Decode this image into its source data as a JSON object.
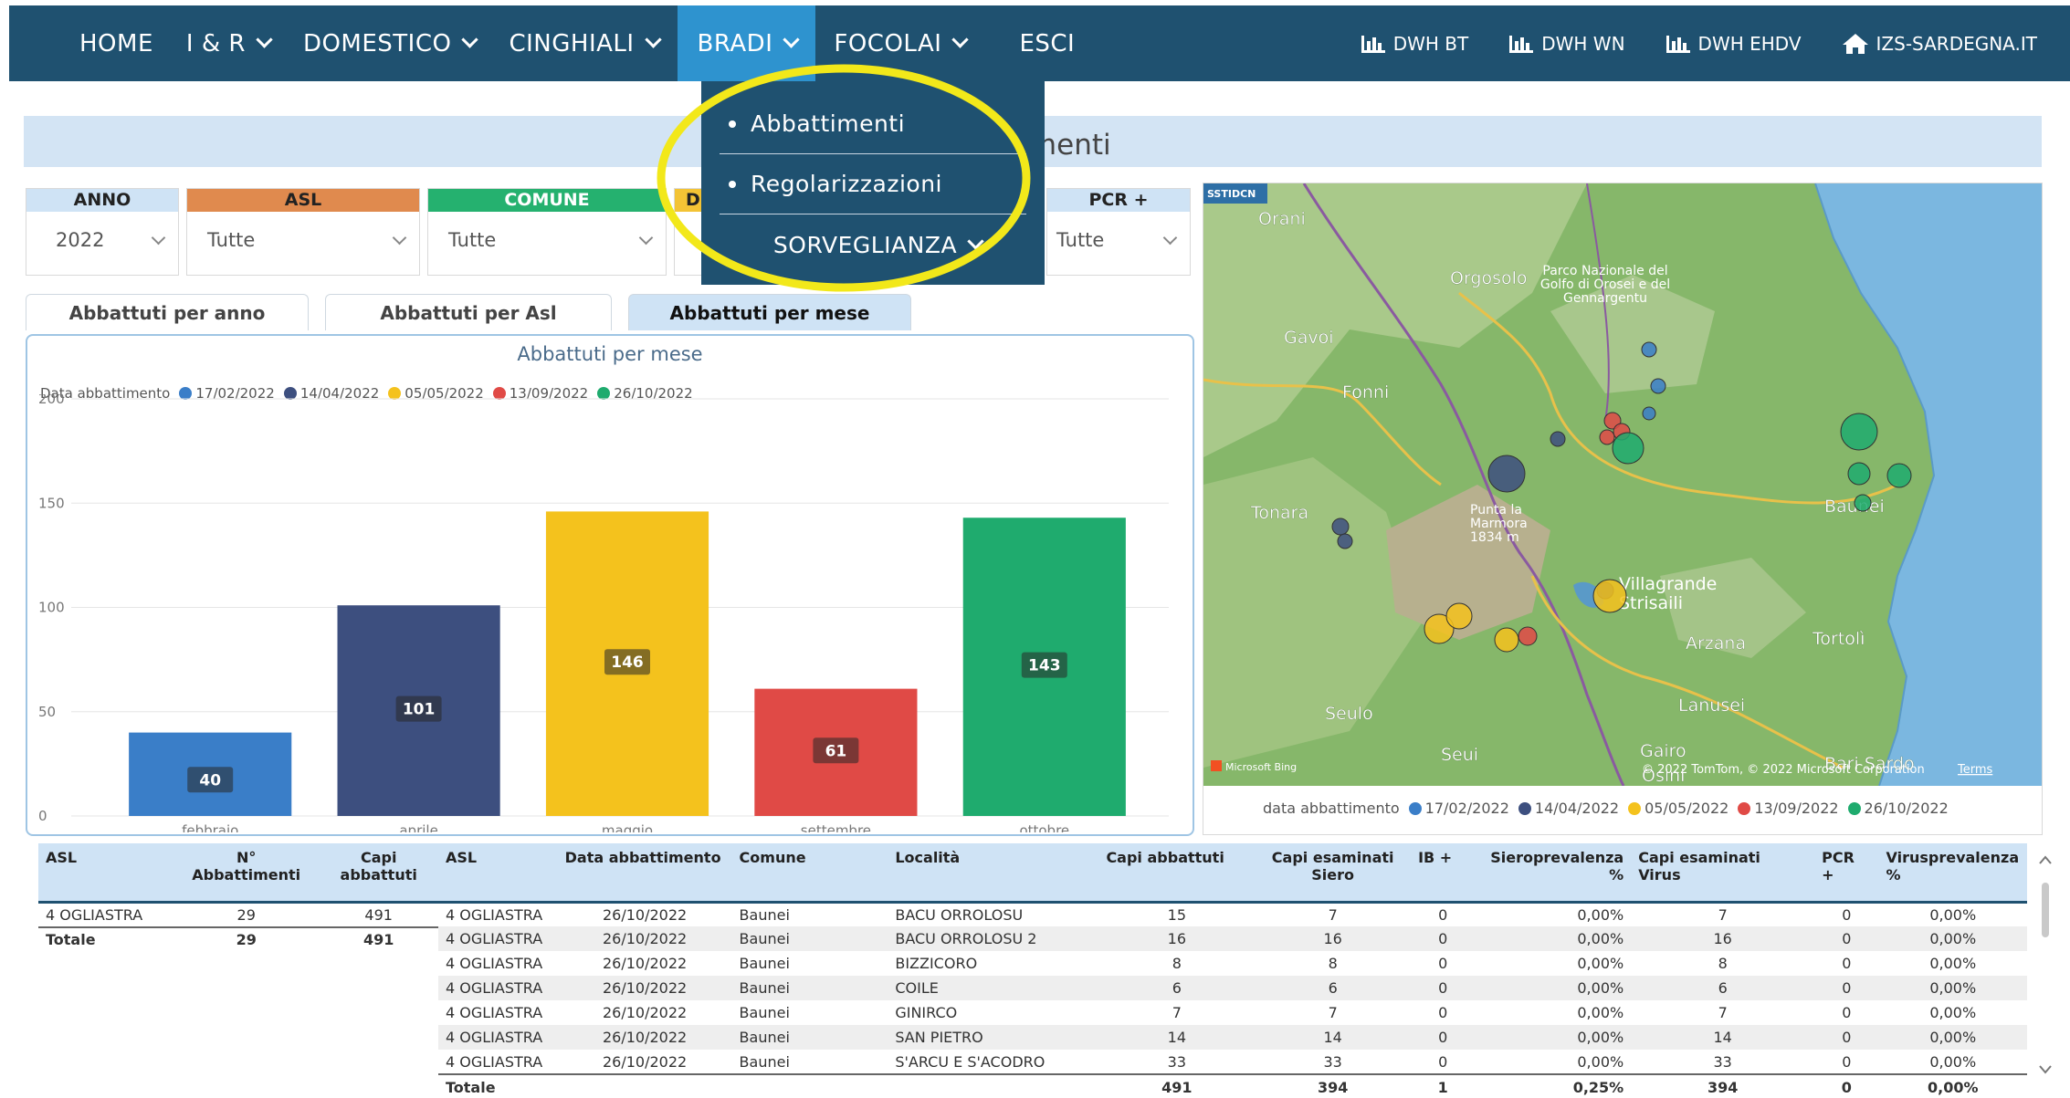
{
  "nav": {
    "items": [
      {
        "label": "HOME",
        "dropdown": false,
        "active": false
      },
      {
        "label": "I & R",
        "dropdown": true,
        "active": false
      },
      {
        "label": "DOMESTICO",
        "dropdown": true,
        "active": false
      },
      {
        "label": "CINGHIALI",
        "dropdown": true,
        "active": false
      },
      {
        "label": "BRADI",
        "dropdown": true,
        "active": true
      },
      {
        "label": "FOCOLAI",
        "dropdown": true,
        "active": false
      },
      {
        "label": "ESCI",
        "dropdown": false,
        "active": false
      }
    ],
    "right": [
      {
        "label": "DWH BT",
        "icon": "bar-chart-icon"
      },
      {
        "label": "DWH WN",
        "icon": "bar-chart-icon"
      },
      {
        "label": "DWH EHDV",
        "icon": "bar-chart-icon"
      },
      {
        "label": "IZS-SARDEGNA.IT",
        "icon": "home-icon"
      }
    ],
    "colors": {
      "bar": "#1f5170",
      "active": "#2e93cf"
    }
  },
  "dropdown_menu": {
    "items": [
      "Abbattimenti",
      "Regolarizzazioni",
      "SORVEGLIANZA"
    ],
    "highlight_color": "#f2e81a"
  },
  "page": {
    "title_visible": "attimenti"
  },
  "slicers": [
    {
      "label": "ANNO",
      "value": "2022",
      "color": "#cfe3f5"
    },
    {
      "label": "ASL",
      "value": "Tutte",
      "color": "#e08a4e"
    },
    {
      "label": "COMUNE",
      "value": "Tutte",
      "color": "#25b16f"
    },
    {
      "label": "D",
      "value": "",
      "color": "#f3c335"
    },
    {
      "label": "PCR +",
      "value": "Tutte",
      "color": "#cfe3f5"
    }
  ],
  "tabs": [
    "Abbattuti per anno",
    "Abbattuti per Asl",
    "Abbattuti per mese"
  ],
  "legend_title": "Data abbattimento",
  "chart_data": {
    "type": "bar",
    "title": "Abbattuti per mese",
    "categories": [
      "febbraio",
      "aprile",
      "maggio",
      "settembre",
      "ottobre"
    ],
    "values": [
      40,
      101,
      146,
      61,
      143
    ],
    "colors": [
      "#3a7ec8",
      "#3d4f7f",
      "#f4c21d",
      "#e04a46",
      "#1fab6e"
    ],
    "legend": [
      "17/02/2022",
      "14/04/2022",
      "05/05/2022",
      "13/09/2022",
      "26/10/2022"
    ],
    "yticks": [
      0,
      50,
      100,
      150,
      200
    ],
    "ylim": [
      0,
      200
    ],
    "grid": true,
    "legend_position": "top-left"
  },
  "map": {
    "legend_title": "data abbattimento",
    "attribution": "© 2022 TomTom, © 2022 Microsoft Corporation",
    "terms": "Terms",
    "bing": "Microsoft Bing",
    "places": [
      "Orani",
      "Orgosolo",
      "Parco Nazionale del Golfo di Orosei e del Gennargentu",
      "Gavoi",
      "Fonni",
      "Tonara",
      "Punta la Marmora 1834 m",
      "Villagrande Strisaili",
      "Baunei",
      "Arzana",
      "Tortolì",
      "Lanusei",
      "Seulo",
      "Seui",
      "Gairo",
      "Osini",
      "Bari Sardo"
    ],
    "corner_tag": "SSTIDCN",
    "bubbles": [
      {
        "cat": 0,
        "size": 8
      },
      {
        "cat": 0,
        "size": 8
      },
      {
        "cat": 0,
        "size": 7
      },
      {
        "cat": 1,
        "size": 20
      },
      {
        "cat": 1,
        "size": 8
      },
      {
        "cat": 1,
        "size": 9
      },
      {
        "cat": 1,
        "size": 8
      },
      {
        "cat": 1,
        "size": 9
      },
      {
        "cat": 2,
        "size": 18
      },
      {
        "cat": 2,
        "size": 16
      },
      {
        "cat": 2,
        "size": 14
      },
      {
        "cat": 2,
        "size": 13
      },
      {
        "cat": 3,
        "size": 10
      },
      {
        "cat": 3,
        "size": 9
      },
      {
        "cat": 3,
        "size": 9
      },
      {
        "cat": 3,
        "size": 8
      },
      {
        "cat": 4,
        "size": 17
      },
      {
        "cat": 4,
        "size": 20
      },
      {
        "cat": 4,
        "size": 13
      },
      {
        "cat": 4,
        "size": 12
      },
      {
        "cat": 4,
        "size": 9
      }
    ]
  },
  "summary_table": {
    "headers": [
      "ASL",
      "N° Abbattimenti",
      "Capi abbattuti"
    ],
    "rows": [
      [
        "4 OGLIASTRA",
        "29",
        "491"
      ]
    ],
    "total": [
      "Totale",
      "29",
      "491"
    ]
  },
  "detail_table": {
    "headers": [
      "ASL",
      "Data abbattimento",
      "Comune",
      "Località",
      "Capi abbattuti",
      "Capi esaminati Siero",
      "IB +",
      "Sieroprevalenza %",
      "Capi esaminati Virus",
      "PCR +",
      "Virusprevalenza %"
    ],
    "rows": [
      [
        "4 OGLIASTRA",
        "26/10/2022",
        "Baunei",
        "BACU ORROLOSU",
        "15",
        "7",
        "0",
        "0,00%",
        "7",
        "0",
        "0,00%"
      ],
      [
        "4 OGLIASTRA",
        "26/10/2022",
        "Baunei",
        "BACU ORROLOSU 2",
        "16",
        "16",
        "0",
        "0,00%",
        "16",
        "0",
        "0,00%"
      ],
      [
        "4 OGLIASTRA",
        "26/10/2022",
        "Baunei",
        "BIZZICORO",
        "8",
        "8",
        "0",
        "0,00%",
        "8",
        "0",
        "0,00%"
      ],
      [
        "4 OGLIASTRA",
        "26/10/2022",
        "Baunei",
        "COILE",
        "6",
        "6",
        "0",
        "0,00%",
        "6",
        "0",
        "0,00%"
      ],
      [
        "4 OGLIASTRA",
        "26/10/2022",
        "Baunei",
        "GINIRCO",
        "7",
        "7",
        "0",
        "0,00%",
        "7",
        "0",
        "0,00%"
      ],
      [
        "4 OGLIASTRA",
        "26/10/2022",
        "Baunei",
        "SAN PIETRO",
        "14",
        "14",
        "0",
        "0,00%",
        "14",
        "0",
        "0,00%"
      ],
      [
        "4 OGLIASTRA",
        "26/10/2022",
        "Baunei",
        "S'ARCU E S'ACODRO",
        "33",
        "33",
        "0",
        "0,00%",
        "33",
        "0",
        "0,00%"
      ]
    ],
    "total": [
      "Totale",
      "",
      "",
      "",
      "491",
      "394",
      "1",
      "0,25%",
      "394",
      "0",
      "0,00%"
    ]
  }
}
